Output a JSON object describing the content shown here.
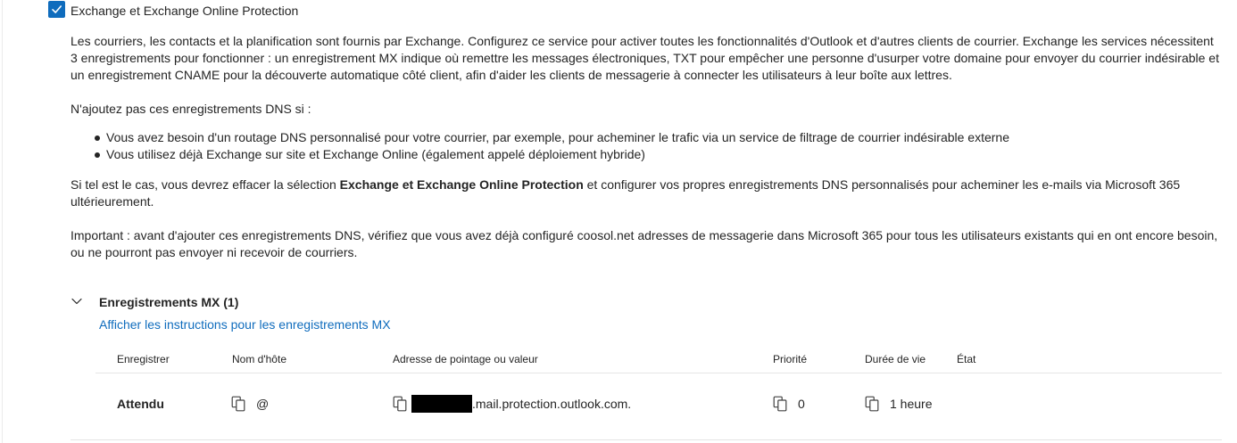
{
  "service": {
    "checkbox_label": "Exchange et Exchange Online Protection",
    "checked": true
  },
  "intro": "Les courriers, les contacts et la planification sont fournis par Exchange. Configurez ce service pour activer toutes les fonctionnalités d'Outlook et d'autres clients de courrier. Exchange les services nécessitent 3 enregistrements pour fonctionner : un enregistrement MX indique où remettre les messages électroniques, TXT pour empêcher une personne d'usurper votre domaine pour envoyer du courrier indésirable et un enregistrement CNAME pour la découverte automatique côté client, afin d'aider les clients de messagerie à connecter les utilisateurs à leur boîte aux lettres.",
  "dont_add_heading": "N'ajoutez pas ces enregistrements DNS si :",
  "bullets": [
    "Vous avez besoin d'un routage DNS personnalisé pour votre courrier, par exemple, pour acheminer le trafic via un service de filtrage de courrier indésirable externe",
    "Vous utilisez déjà Exchange sur site et Exchange Online (également appelé déploiement hybride)"
  ],
  "clear_note": {
    "before": "Si tel est le cas, vous devrez effacer la sélection ",
    "bold": "Exchange et Exchange Online Protection",
    "after": " et configurer vos propres enregistrements DNS personnalisés pour acheminer les e-mails via Microsoft 365 ultérieurement."
  },
  "important": "Important : avant d'ajouter ces enregistrements DNS, vérifiez que vous avez déjà configuré coosol.net adresses de messagerie dans Microsoft 365 pour tous les utilisateurs existants qui en ont encore besoin, ou ne pourront pas envoyer ni recevoir de courriers.",
  "mx_section": {
    "title": "Enregistrements MX (1)",
    "instructions_link": "Afficher les instructions pour les enregistrements MX",
    "columns": [
      "Enregistrer",
      "Nom d'hôte",
      "Adresse de pointage ou valeur",
      "Priorité",
      "Durée de vie",
      "État"
    ],
    "rows": [
      {
        "record": "Attendu",
        "hostname": "@",
        "value_suffix": ".mail.protection.outlook.com.",
        "priority": "0",
        "ttl": "1 heure",
        "status": ""
      }
    ]
  },
  "icons": {
    "checkbox": "checkmark-icon",
    "section_toggle": "chevron-down-icon",
    "copy": "copy-icon"
  },
  "colors": {
    "accent": "#0f6cbd",
    "text": "#242424",
    "divider": "#e5e5e5",
    "redaction": "#000000"
  }
}
